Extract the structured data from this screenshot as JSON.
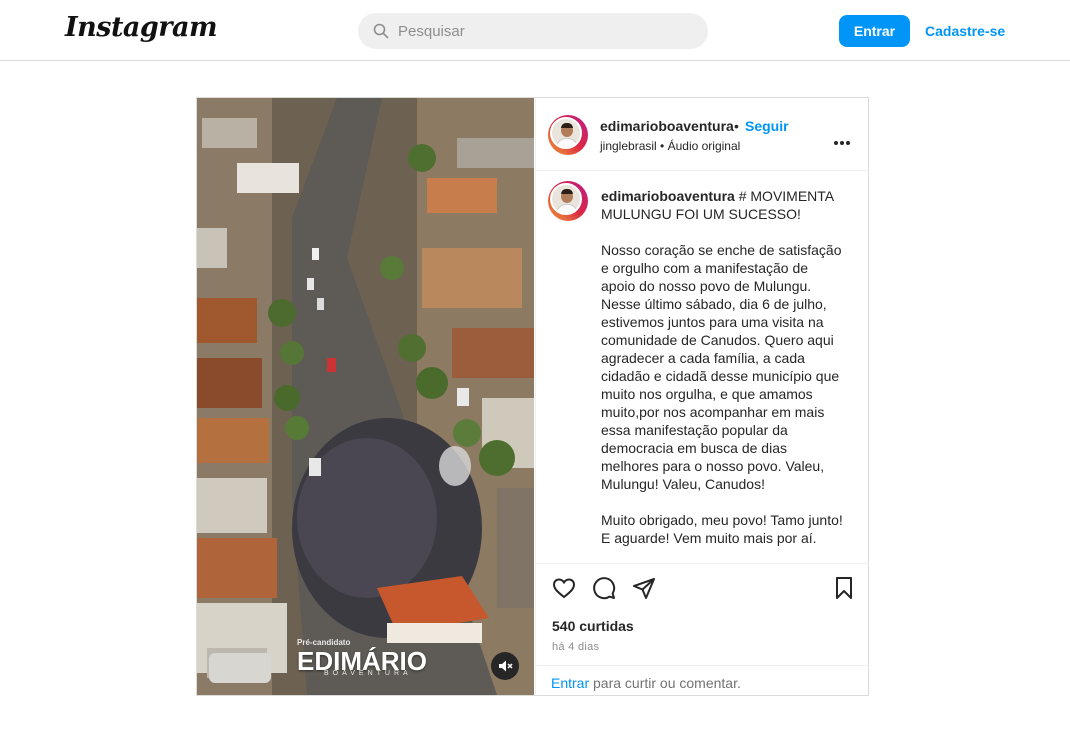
{
  "header": {
    "logo": "Instagram",
    "search_placeholder": "Pesquisar",
    "login_label": "Entrar",
    "signup_label": "Cadastre-se"
  },
  "post": {
    "username": "edimarioboaventura",
    "separator": "•",
    "follow_label": "Seguir",
    "audio_user": "jinglebrasil",
    "audio_label": "Áudio original",
    "media": {
      "overlay_small": "Pré-candidato",
      "overlay_name": "EDIMÁRIO",
      "overlay_surname": "BOAVENTURA"
    },
    "caption_username": "edimarioboaventura",
    "caption_text": " # MOVIMENTA MULUNGU FOI UM SUCESSO!\n\nNosso coração se enche de satisfação e orgulho com a manifestação de apoio do nosso povo de Mulungu. Nesse último sábado, dia 6 de julho, estivemos juntos para uma visita na comunidade de Canudos. Quero aqui agradecer a cada família, a cada cidadão e cidadã desse município que muito nos orgulha, e que amamos muito,por nos acompanhar em mais essa manifestação popular da democracia em busca de dias melhores para o nosso povo. Valeu, Mulungu! Valeu, Canudos!\n\nMuito obrigado, meu povo! Tamo junto! E aguarde! Vem muito mais por aí.",
    "likes": "540 curtidas",
    "date": "há 4 dias",
    "comment_link": "Entrar",
    "comment_rest": " para curtir ou comentar."
  },
  "icons": [
    "search-icon",
    "more-options-icon",
    "heart-icon",
    "comment-icon",
    "share-icon",
    "bookmark-icon",
    "mute-icon"
  ],
  "colors": {
    "accent": "#0095f6",
    "border": "#dbdbdb",
    "muted": "#8e8e8e"
  }
}
